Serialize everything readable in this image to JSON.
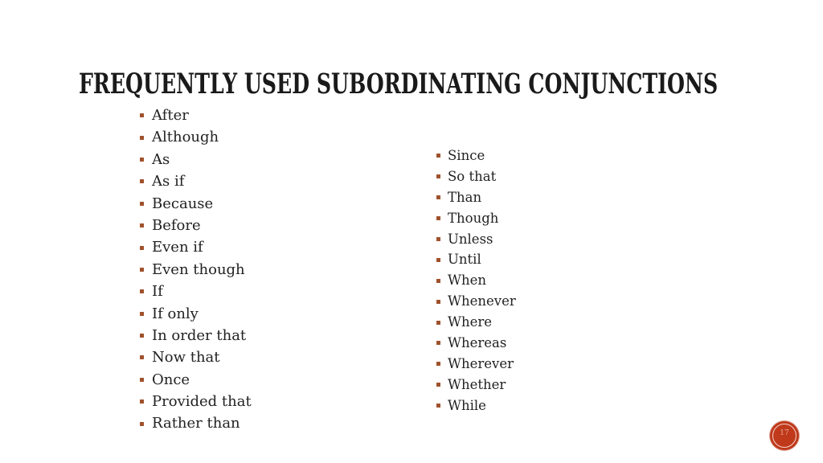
{
  "slide": {
    "title": "FREQUENTLY USED SUBORDINATING CONJUNCTIONS",
    "accent_color": "#c0391b",
    "bullet_color": "#a0522d",
    "column_left": [
      "After",
      "Although",
      "As",
      "As if",
      "Because",
      "Before",
      "Even if",
      "Even though",
      "If",
      "If only",
      "In order that",
      "Now that",
      "Once",
      "Provided that",
      "Rather than"
    ],
    "column_right": [
      "Since",
      "So that",
      "Than",
      "Though",
      "Unless",
      "Until",
      "When",
      "Whenever",
      "Where",
      "Whereas",
      "Wherever",
      "Whether",
      "While"
    ],
    "slide_number": "17"
  }
}
